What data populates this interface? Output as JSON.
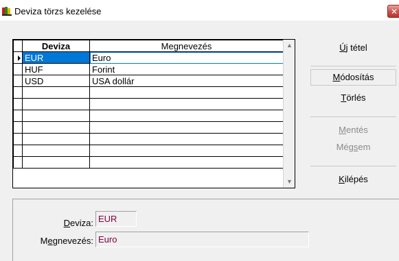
{
  "window": {
    "title": "Deviza törzs kezelése",
    "close_glyph": "✕",
    "icon": "books-app-icon"
  },
  "grid": {
    "columns": [
      "Deviza",
      "Megnevezés"
    ],
    "selected_row": 0,
    "rows": [
      {
        "code": "EUR",
        "name": "Euro"
      },
      {
        "code": "HUF",
        "name": "Forint"
      },
      {
        "code": "USD",
        "name": "USA dollár"
      },
      {
        "code": "",
        "name": ""
      },
      {
        "code": "",
        "name": ""
      },
      {
        "code": "",
        "name": ""
      },
      {
        "code": "",
        "name": ""
      },
      {
        "code": "",
        "name": ""
      },
      {
        "code": "",
        "name": ""
      },
      {
        "code": "",
        "name": ""
      }
    ]
  },
  "buttons": {
    "new": {
      "pre": "",
      "acc": "Ú",
      "post": "j tétel"
    },
    "modify": {
      "pre": "",
      "acc": "M",
      "post": "ódosítás"
    },
    "delete": {
      "pre": "",
      "acc": "T",
      "post": "örlés"
    },
    "save": {
      "pre": "",
      "acc": "M",
      "post": "entés"
    },
    "cancel": {
      "pre": "Még",
      "acc": "s",
      "post": "em"
    },
    "exit": {
      "pre": "",
      "acc": "K",
      "post": "ilépés"
    }
  },
  "form": {
    "currency_label": {
      "pre": "",
      "acc": "D",
      "post": "eviza:"
    },
    "currency_value": "EUR",
    "name_label": {
      "pre": "M",
      "acc": "e",
      "post": "gnevezés:"
    },
    "name_value": "Euro"
  },
  "colors": {
    "selection": "#0078d7",
    "field_text": "#800040",
    "disabled_text": "#8a8a8a"
  }
}
